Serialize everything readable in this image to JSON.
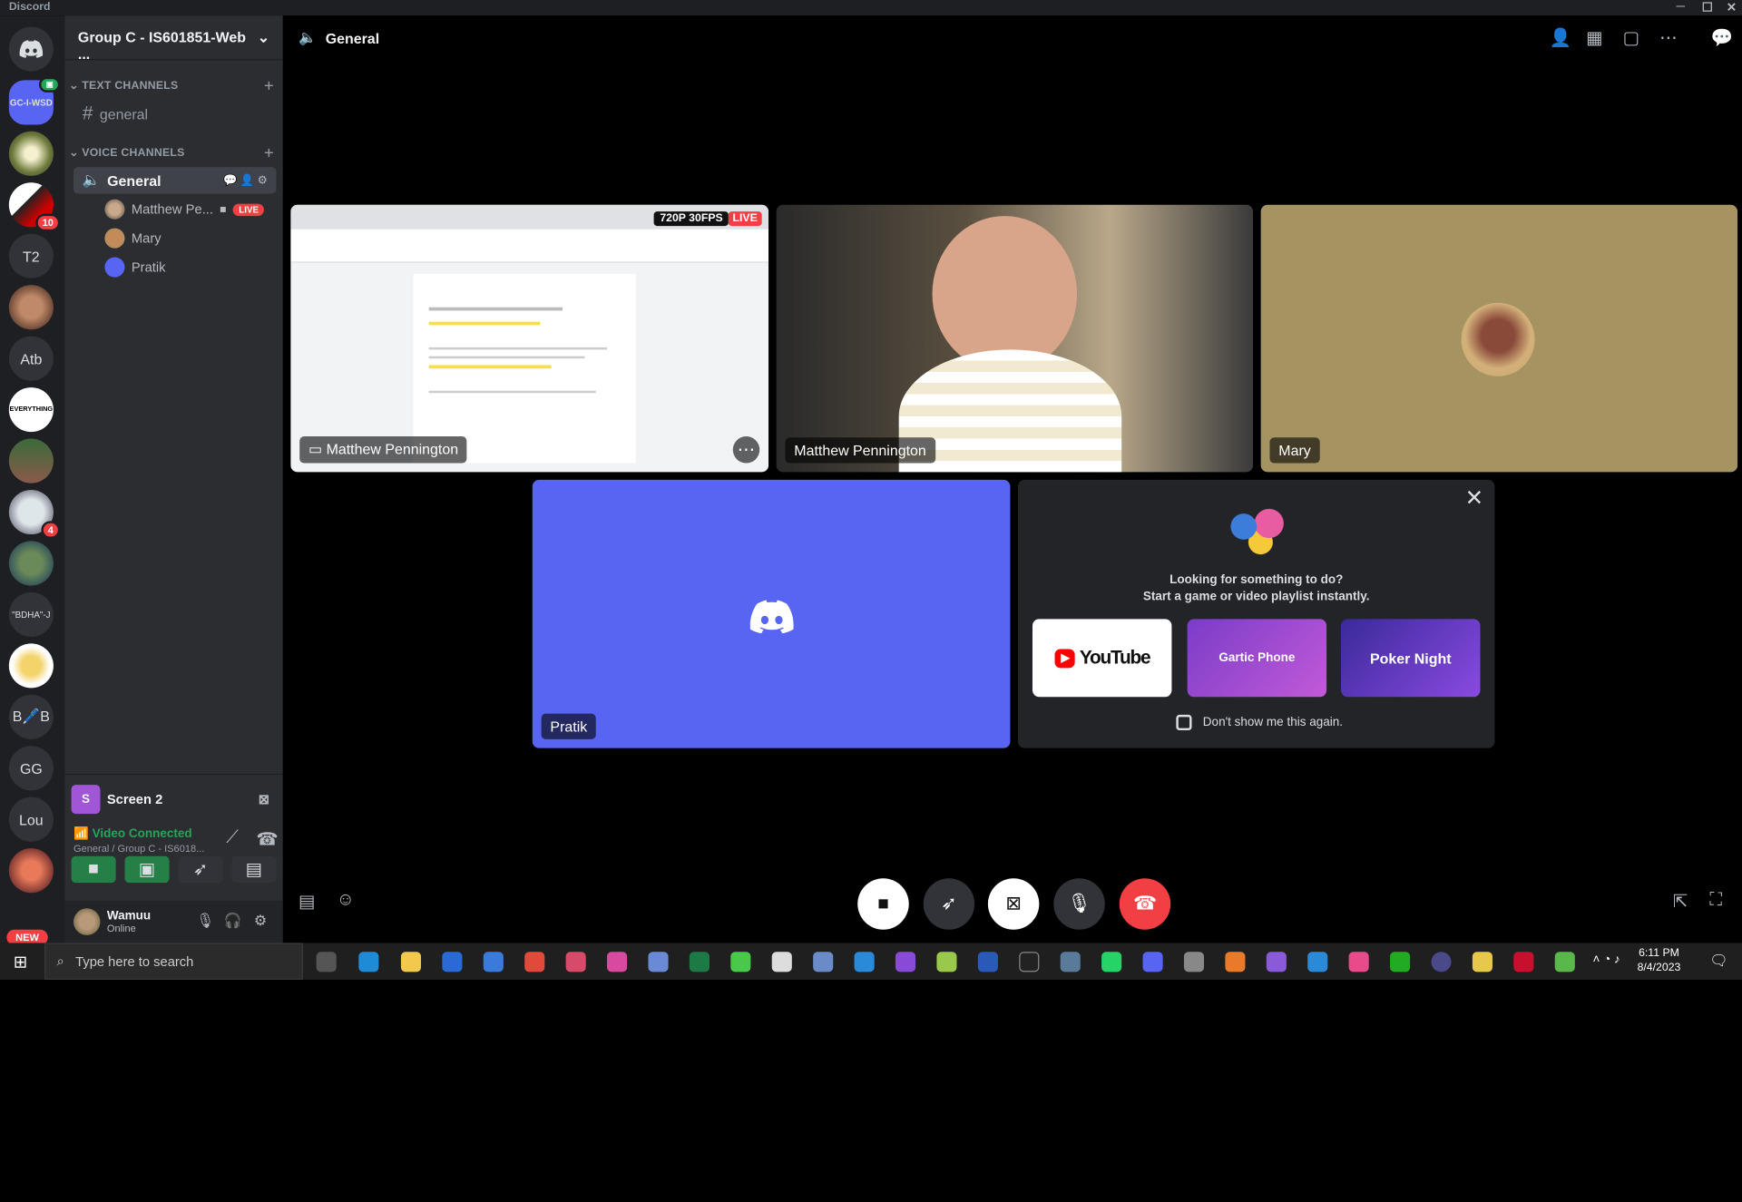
{
  "window": {
    "title": "Discord"
  },
  "servers": [
    {
      "label": "GC-I-WSD",
      "badge": ""
    },
    {
      "label": "T2",
      "badge": ""
    },
    {
      "label": "Atb",
      "badge": ""
    },
    {
      "label": "\"BDHA\"-J",
      "badge": ""
    },
    {
      "label": "B🖊️B",
      "badge": ""
    },
    {
      "label": "GG",
      "badge": ""
    },
    {
      "label": "Lou",
      "badge": ""
    }
  ],
  "server_badges": {
    "b1": "10",
    "b2": "4",
    "new": "NEW"
  },
  "sidebar": {
    "guild_name": "Group C - IS601851-Web ...",
    "text_category": "TEXT CHANNELS",
    "text_channel": "general",
    "voice_category": "VOICE CHANNELS",
    "voice_channel": "General",
    "members": [
      {
        "name": "Matthew Pe...",
        "live": "LIVE"
      },
      {
        "name": "Mary"
      },
      {
        "name": "Pratik"
      }
    ],
    "screen_share": "Screen 2",
    "voice_status": "Video Connected",
    "voice_location": "General / Group C - IS6018...",
    "user": {
      "name": "Wamuu",
      "status": "Online"
    }
  },
  "main": {
    "channel": "General",
    "tiles": {
      "screen": {
        "name": "Matthew Pennington",
        "quality": "720P 30FPS",
        "live": "LIVE"
      },
      "camera": {
        "name": "Matthew Pennington"
      },
      "mary": {
        "name": "Mary"
      },
      "pratik": {
        "name": "Pratik"
      }
    },
    "activity": {
      "line1": "Looking for something to do?",
      "line2": "Start a game or video playlist instantly.",
      "apps": [
        "YouTube",
        "Gartic Phone",
        "Poker Night"
      ],
      "dont_show": "Don't show me this again."
    }
  },
  "taskbar": {
    "search_placeholder": "Type here to search",
    "time": "6:11 PM",
    "date": "8/4/2023"
  },
  "colors": {
    "blurple": "#5865f2",
    "green": "#248046",
    "red": "#f23f43",
    "bg_sidebar": "#2b2d31",
    "bg_rail": "#1e1f22",
    "mary_tile": "#a59362"
  }
}
